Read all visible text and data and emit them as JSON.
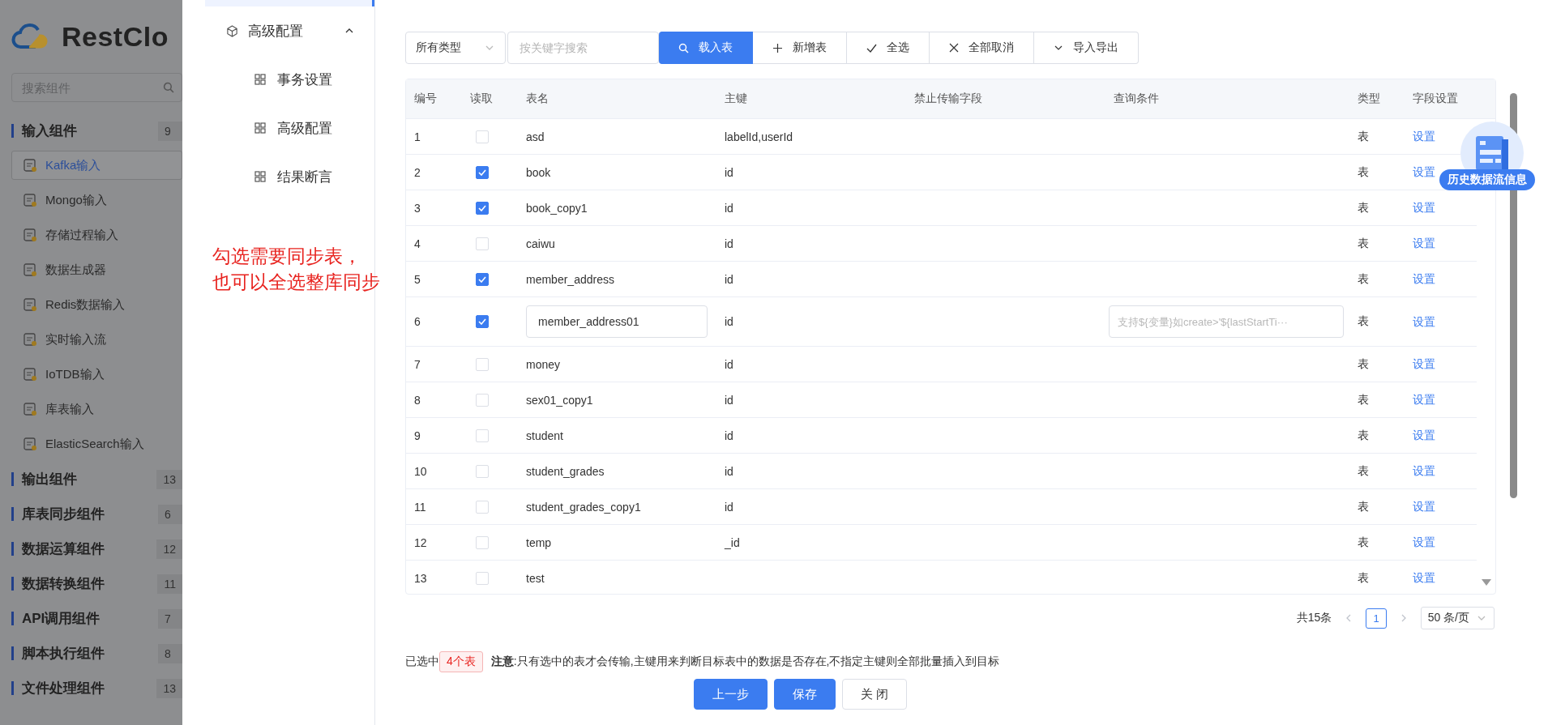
{
  "sidebar": {
    "logo": "RestClo",
    "search": {
      "placeholder": "搜索组件"
    },
    "groups": [
      {
        "label": "输入组件",
        "count": "9",
        "items": [
          {
            "label": "Kafka输入",
            "selected": true
          },
          {
            "label": "Mongo输入",
            "selected": false
          },
          {
            "label": "存储过程输入",
            "selected": false
          },
          {
            "label": "数据生成器",
            "selected": false
          },
          {
            "label": "Redis数据输入",
            "selected": false
          },
          {
            "label": "实时输入流",
            "selected": false
          },
          {
            "label": "IoTDB输入",
            "selected": false
          },
          {
            "label": "库表输入",
            "selected": false
          },
          {
            "label": "ElasticSearch输入",
            "selected": false
          }
        ]
      },
      {
        "label": "输出组件",
        "count": "13"
      },
      {
        "label": "库表同步组件",
        "count": "6"
      },
      {
        "label": "数据运算组件",
        "count": "12"
      },
      {
        "label": "数据转换组件",
        "count": "11"
      },
      {
        "label": "API调用组件",
        "count": "7"
      },
      {
        "label": "脚本执行组件",
        "count": "8"
      },
      {
        "label": "文件处理组件",
        "count": "13"
      }
    ]
  },
  "nav": {
    "items": [
      {
        "label": "高级配置",
        "expanded": true,
        "children": [
          {
            "label": "事务设置"
          },
          {
            "label": "高级配置"
          },
          {
            "label": "结果断言"
          }
        ]
      }
    ]
  },
  "annotation": [
    "勾选需要同步表，",
    "也可以全选整库同步"
  ],
  "toolbar": {
    "type_select": "所有类型",
    "search": {
      "placeholder": "按关键字搜索"
    },
    "buttons": [
      {
        "label": "载入表",
        "kind": "primary"
      },
      {
        "label": "新增表",
        "kind": "default"
      },
      {
        "label": "全选",
        "kind": "default"
      },
      {
        "label": "全部取消",
        "kind": "default"
      },
      {
        "label": "导入导出",
        "kind": "default"
      }
    ]
  },
  "table": {
    "columns": [
      "编号",
      "读取",
      "表名",
      "主键",
      "禁止传输字段",
      "查询条件",
      "类型",
      "字段设置"
    ],
    "rows": [
      {
        "no": "1",
        "read": false,
        "name": "asd",
        "editing": false,
        "key": "labelId,userId",
        "type": "表",
        "action": "设置"
      },
      {
        "no": "2",
        "read": true,
        "name": "book",
        "editing": false,
        "key": "id",
        "type": "表",
        "action": "设置"
      },
      {
        "no": "3",
        "read": true,
        "name": "book_copy1",
        "editing": false,
        "key": "id",
        "type": "表",
        "action": "设置"
      },
      {
        "no": "4",
        "read": false,
        "name": "caiwu",
        "editing": false,
        "key": "id",
        "type": "表",
        "action": "设置"
      },
      {
        "no": "5",
        "read": true,
        "name": "member_address",
        "editing": false,
        "key": "id",
        "type": "表",
        "action": "设置"
      },
      {
        "no": "6",
        "read": true,
        "name": "member_address01",
        "editing": true,
        "key": "id",
        "query": {
          "placeholder": "支持${变量}如create>'${lastStartTi···"
        },
        "type": "表",
        "action": "设置"
      },
      {
        "no": "7",
        "read": false,
        "name": "money",
        "editing": false,
        "key": "id",
        "type": "表",
        "action": "设置"
      },
      {
        "no": "8",
        "read": false,
        "name": "sex01_copy1",
        "editing": false,
        "key": "id",
        "type": "表",
        "action": "设置"
      },
      {
        "no": "9",
        "read": false,
        "name": "student",
        "editing": false,
        "key": "id",
        "type": "表",
        "action": "设置"
      },
      {
        "no": "10",
        "read": false,
        "name": "student_grades",
        "editing": false,
        "key": "id",
        "type": "表",
        "action": "设置"
      },
      {
        "no": "11",
        "read": false,
        "name": "student_grades_copy1",
        "editing": false,
        "key": "id",
        "type": "表",
        "action": "设置"
      },
      {
        "no": "12",
        "read": false,
        "name": "temp",
        "editing": false,
        "key": "_id",
        "type": "表",
        "action": "设置"
      },
      {
        "no": "13",
        "read": false,
        "name": "test",
        "editing": false,
        "type": "表",
        "action": "设置"
      }
    ]
  },
  "pagination": {
    "total": "共15条",
    "pages": [
      {
        "label": "1",
        "selected": true
      }
    ],
    "page_size": "50 条/页"
  },
  "footer": {
    "selected_prefix": "已选中",
    "selected_count": "4个表",
    "note": "**注意**:只有选中的表才会传输,主键用来判断目标表中的数据是否存在,不指定主键则全部批量插入到目标"
  },
  "buttons": [
    {
      "label": "上一步",
      "kind": "primary"
    },
    {
      "label": "保存",
      "kind": "primary"
    },
    {
      "label": "关 闭",
      "kind": "default"
    }
  ],
  "history_widget": {
    "label": "历史数据流信息"
  }
}
